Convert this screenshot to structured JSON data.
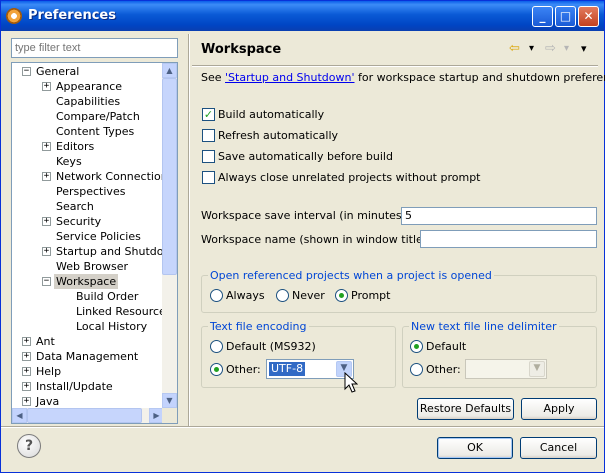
{
  "window": {
    "title": "Preferences"
  },
  "titlebar_buttons": {
    "minimize": "_",
    "maximize": "□",
    "close": "✕"
  },
  "filter": {
    "placeholder": "type filter text"
  },
  "tree": [
    {
      "label": "General",
      "level": 0,
      "expander": "−"
    },
    {
      "label": "Appearance",
      "level": 1,
      "expander": "+"
    },
    {
      "label": "Capabilities",
      "level": 1,
      "expander": ""
    },
    {
      "label": "Compare/Patch",
      "level": 1,
      "expander": ""
    },
    {
      "label": "Content Types",
      "level": 1,
      "expander": ""
    },
    {
      "label": "Editors",
      "level": 1,
      "expander": "+"
    },
    {
      "label": "Keys",
      "level": 1,
      "expander": ""
    },
    {
      "label": "Network Connections",
      "level": 1,
      "expander": "+"
    },
    {
      "label": "Perspectives",
      "level": 1,
      "expander": ""
    },
    {
      "label": "Search",
      "level": 1,
      "expander": ""
    },
    {
      "label": "Security",
      "level": 1,
      "expander": "+"
    },
    {
      "label": "Service Policies",
      "level": 1,
      "expander": ""
    },
    {
      "label": "Startup and Shutdown",
      "level": 1,
      "expander": "+"
    },
    {
      "label": "Web Browser",
      "level": 1,
      "expander": ""
    },
    {
      "label": "Workspace",
      "level": 1,
      "expander": "−",
      "selected": true
    },
    {
      "label": "Build Order",
      "level": 2,
      "expander": ""
    },
    {
      "label": "Linked Resources",
      "level": 2,
      "expander": ""
    },
    {
      "label": "Local History",
      "level": 2,
      "expander": ""
    },
    {
      "label": "Ant",
      "level": 0,
      "expander": "+"
    },
    {
      "label": "Data Management",
      "level": 0,
      "expander": "+"
    },
    {
      "label": "Help",
      "level": 0,
      "expander": "+"
    },
    {
      "label": "Install/Update",
      "level": 0,
      "expander": "+"
    },
    {
      "label": "Java",
      "level": 0,
      "expander": "+"
    }
  ],
  "page": {
    "title": "Workspace",
    "nav": {
      "back": "⇦",
      "back_menu": "▾",
      "forward": "⇨",
      "forward_menu": "▾",
      "view_menu": "▾"
    },
    "desc_prefix": "See ",
    "desc_link": "'Startup and Shutdown'",
    "desc_suffix": " for workspace startup and shutdown preferences.",
    "checkboxes": [
      {
        "label": "Build automatically",
        "checked": true
      },
      {
        "label": "Refresh automatically",
        "checked": false
      },
      {
        "label": "Save automatically before build",
        "checked": false
      },
      {
        "label": "Always close unrelated projects without prompt",
        "checked": false
      }
    ],
    "save_interval_label": "Workspace save interval (in minutes):",
    "save_interval_value": "5",
    "workspace_name_label": "Workspace name (shown in window title):",
    "workspace_name_value": "",
    "open_ref_group": {
      "title": "Open referenced projects when a project is opened",
      "options": [
        "Always",
        "Never",
        "Prompt"
      ],
      "selected": "Prompt"
    },
    "encoding_group": {
      "title": "Text file encoding",
      "default_label": "Default (MS932)",
      "other_label": "Other:",
      "other_value": "UTF-8",
      "selected": "Other"
    },
    "delimiter_group": {
      "title": "New text file line delimiter",
      "default_label": "Default",
      "other_label": "Other:",
      "other_value": "",
      "selected": "Default"
    },
    "restore_defaults_label": "Restore Defaults",
    "apply_label": "Apply"
  },
  "footer": {
    "help": "?",
    "ok_label": "OK",
    "cancel_label": "Cancel"
  },
  "colors": {
    "title_bar": "#0a5ad6",
    "group_title": "#0046d5",
    "link": "#0000ee",
    "selection": "#316ac5"
  },
  "icons": [
    "eclipse-app-icon",
    "minimize-icon",
    "maximize-icon",
    "close-icon",
    "back-arrow-icon",
    "forward-arrow-icon",
    "view-menu-icon",
    "help-icon",
    "mouse-cursor-icon"
  ]
}
